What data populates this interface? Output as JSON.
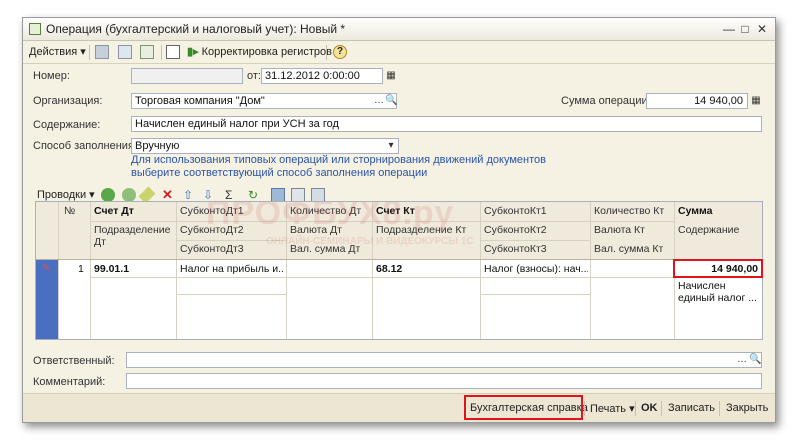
{
  "window": {
    "title": "Операция (бухгалтерский и налоговый учет): Новый *"
  },
  "toolbar": {
    "actions_label": "Действия",
    "correction_label": "Корректировка регистров",
    "help_label": "?"
  },
  "form": {
    "number_label": "Номер:",
    "number_value": "",
    "date_label": "от:",
    "date_value": "31.12.2012  0:00:00",
    "org_label": "Организация:",
    "org_value": "Торговая компания \"Дом\"",
    "sum_label": "Сумма операции:",
    "sum_value": "14 940,00",
    "content_label": "Содержание:",
    "content_value": "Начислен единый налог при УСН за год",
    "fill_label": "Способ заполнения:",
    "fill_value": "Вручную",
    "hint_line1": "Для использования типовых операций или сторнирования движений документов",
    "hint_line2": "выберите соответствующий способ заполнения операции"
  },
  "grid_toolbar": {
    "entries_label": "Проводки"
  },
  "grid": {
    "headers": {
      "num": "№",
      "dt_account": "Счет Дт",
      "subconto_dt1": "СубконтоДт1",
      "qty_dt": "Количество Дт",
      "kt_account": "Счет Кт",
      "subconto_kt1": "СубконтоКт1",
      "qty_kt": "Количество Кт",
      "sum": "Сумма",
      "division_dt": "Подразделение Дт",
      "subconto_dt2": "СубконтоДт2",
      "currency_dt": "Валюта Дт",
      "division_kt": "Подразделение Кт",
      "subconto_kt2": "СубконтоКт2",
      "currency_kt": "Валюта Кт",
      "content": "Содержание",
      "subconto_dt3": "СубконтоДт3",
      "cur_sum_dt": "Вал. сумма Дт",
      "subconto_kt3": "СубконтоКт3",
      "cur_sum_kt": "Вал. сумма Кт"
    },
    "row": {
      "num": "1",
      "dt_account": "99.01.1",
      "subconto_dt1": "Налог на прибыль и...",
      "kt_account": "68.12",
      "subconto_kt1": "Налог (взносы): нач...",
      "sum": "14 940,00",
      "content_line1": "Начислен",
      "content_line2": "единый налог ..."
    }
  },
  "footer_fields": {
    "responsible_label": "Ответственный:",
    "responsible_value": "",
    "comment_label": "Комментарий:",
    "comment_value": ""
  },
  "bottom_bar": {
    "accounting_note": "Бухгалтерская справка",
    "print": "Печать",
    "ok": "OK",
    "save": "Записать",
    "close": "Закрыть"
  },
  "watermark": {
    "line1": "ПРОФБУХ8.ру",
    "line2": "ОНЛАЙН-СЕМИНАРЫ И ВИДЕОКУРСЫ 1С"
  },
  "colors": {
    "highlight_red": "#e0141c",
    "row_marker": "#4a6fc0",
    "link_blue": "#2a54a8",
    "window_bg": "#f5f1e3"
  }
}
